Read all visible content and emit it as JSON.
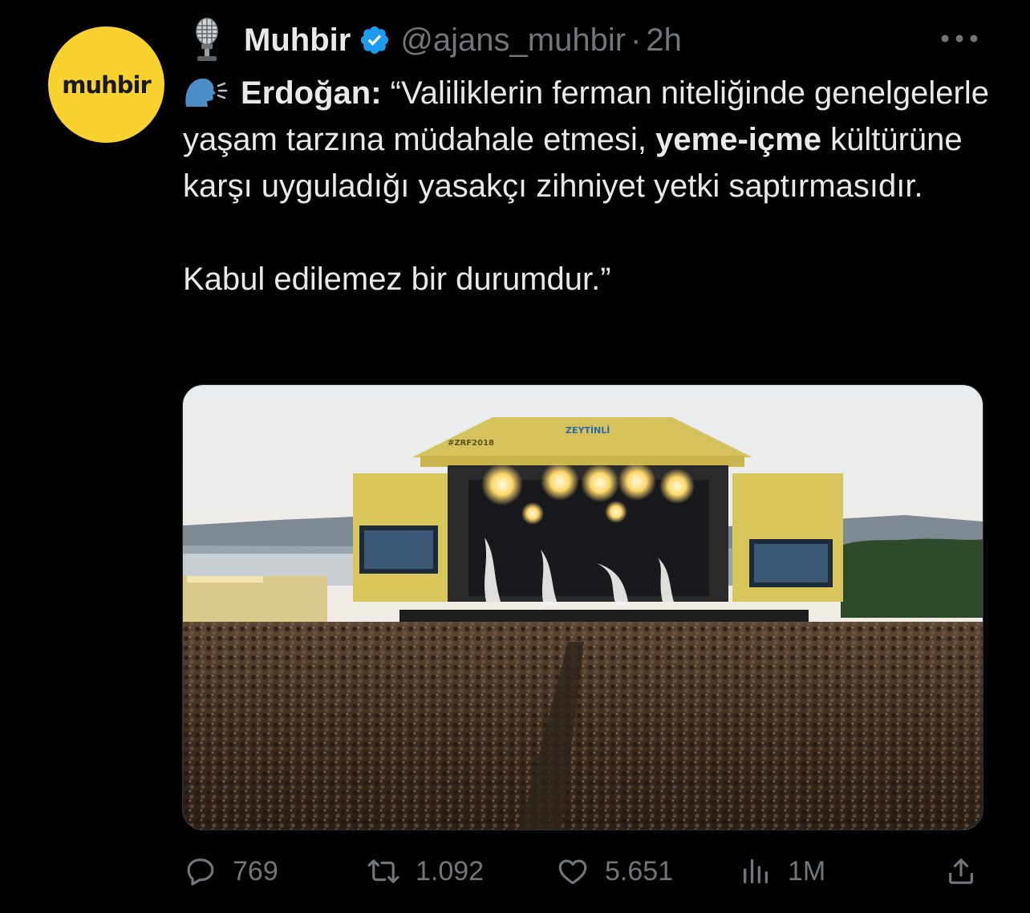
{
  "author": {
    "display_name": "Muhbir",
    "handle": "@ajans_muhbir",
    "separator": "·",
    "time": "2h",
    "avatar_text": "muhbir",
    "avatar_color": "#f9d230",
    "verified_color": "#1d9bf0",
    "verified": true,
    "mic_icon": "microphone-emoji-icon"
  },
  "tweet": {
    "speaker_icon": "speaking-head-emoji-icon",
    "quote_speaker": "Erdoğan",
    "colon": ":",
    "line1_rest": " “Valiliklerin ferman niteliğinde genelgelerle yaşam tarzına müdahale etmesi,",
    "bold_phrase": "yeme-içme",
    "line2_rest": " kültürüne karşı uyguladığı yasakçı zihniyet yetki saptırmasıdır.",
    "paragraph2": "Kabul edilemez bir durumdur.”"
  },
  "media": {
    "stage_hashtag": "#ZRF2018",
    "stage_banner": "ZEYTİNLİ"
  },
  "actions": {
    "replies": "769",
    "retweets": "1.092",
    "likes": "5.651",
    "views": "1M",
    "icon_color": "#71767b"
  }
}
